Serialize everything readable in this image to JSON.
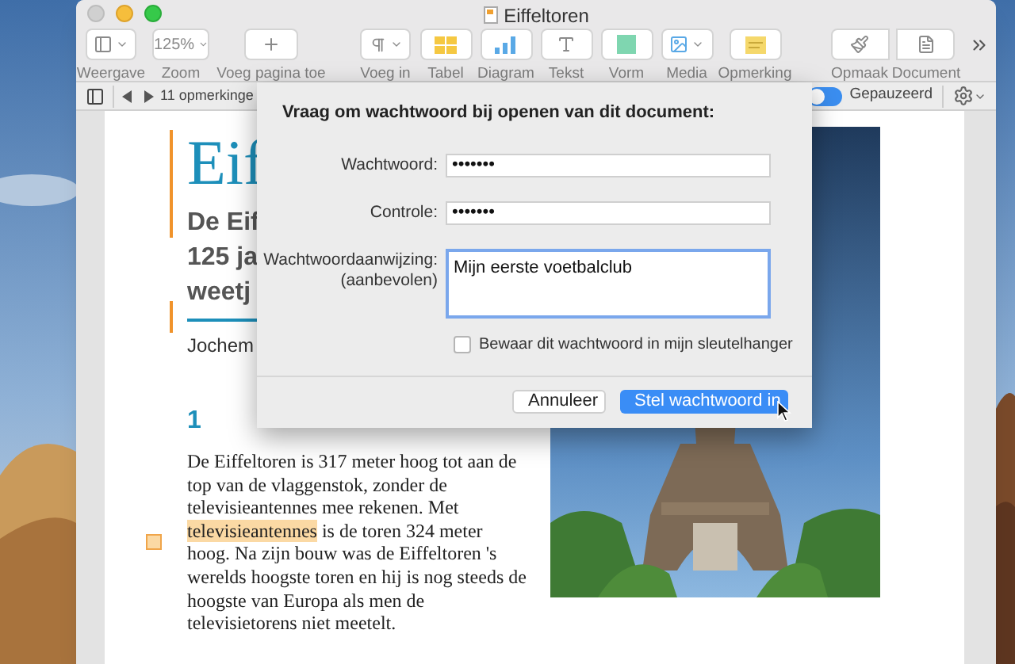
{
  "window": {
    "title": "Eiffeltoren"
  },
  "toolbar": [
    {
      "kind": "view",
      "label": "Weergave"
    },
    {
      "kind": "zoom",
      "label": "Zoom",
      "value": "125%"
    },
    {
      "kind": "add_page",
      "label": "Voeg pagina toe"
    },
    {
      "kind": "insert",
      "label": "Voeg in"
    },
    {
      "kind": "table",
      "label": "Tabel"
    },
    {
      "kind": "chart",
      "label": "Diagram"
    },
    {
      "kind": "text",
      "label": "Tekst"
    },
    {
      "kind": "shape",
      "label": "Vorm"
    },
    {
      "kind": "media",
      "label": "Media"
    },
    {
      "kind": "comment",
      "label": "Opmerking"
    },
    {
      "kind": "format",
      "label": "Opmaak"
    },
    {
      "kind": "document",
      "label": "Document"
    },
    {
      "kind": "more"
    }
  ],
  "comments_bar": {
    "count": "11 opmerkinge",
    "on": false,
    "status": "Gepauzeerd"
  },
  "document": {
    "title": "Eif",
    "subtitle_lines": [
      "De Eif",
      "125 ja",
      "weetj"
    ],
    "author": "Jochem",
    "section_number": "1",
    "paragraph": {
      "before": "De Eiffeltoren is 317 meter hoog tot aan de top van de vlaggenstok, zonder de televisieantennes mee rekenen. Met",
      "highlight": "televisieantennes",
      "after": "is de toren 324 meter hoog. Na zijn bouw was de Eiffeltoren 's werelds hoogste toren en hij is nog steeds de hoogste van Europa als men de televisietorens niet meetelt.",
      "has_comment": true
    }
  },
  "dialog": {
    "title": "Vraag om wachtwoord bij openen van dit document:",
    "fields": [
      {
        "kind": "line",
        "label": "Wachtwoord:",
        "value": "•••••••",
        "focused": false
      },
      {
        "kind": "line",
        "label": "Controle:",
        "value": "•••••••",
        "focused": false
      },
      {
        "kind": "area",
        "label": "Wachtwoordaanwijzing:",
        "sublabel": "(aanbevolen)",
        "value": "Mijn eerste voetbalclub",
        "focused": true
      }
    ],
    "keychain": {
      "label": "Bewaar dit wachtwoord in mijn sleutelhanger",
      "checked": false
    },
    "buttons": [
      {
        "label": "Annuleer",
        "default": false
      },
      {
        "label": "Stel wachtwoord in",
        "default": true
      }
    ]
  }
}
